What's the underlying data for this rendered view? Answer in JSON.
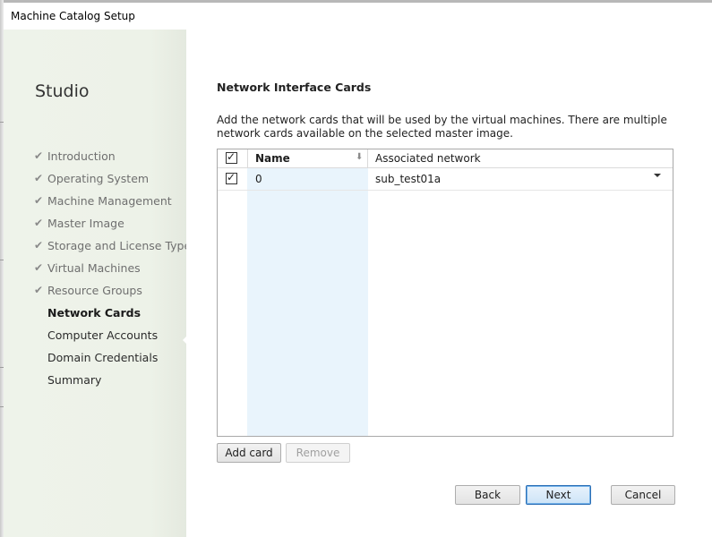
{
  "window": {
    "title": "Machine Catalog Setup"
  },
  "sidebar": {
    "heading": "Studio",
    "items": [
      {
        "label": "Introduction",
        "state": "done"
      },
      {
        "label": "Operating System",
        "state": "done"
      },
      {
        "label": "Machine Management",
        "state": "done"
      },
      {
        "label": "Master Image",
        "state": "done"
      },
      {
        "label": "Storage and License Types",
        "state": "done"
      },
      {
        "label": "Virtual Machines",
        "state": "done"
      },
      {
        "label": "Resource Groups",
        "state": "done"
      },
      {
        "label": "Network Cards",
        "state": "active"
      },
      {
        "label": "Computer Accounts",
        "state": "pending"
      },
      {
        "label": "Domain Credentials",
        "state": "pending"
      },
      {
        "label": "Summary",
        "state": "pending"
      }
    ],
    "check_glyph": "✔"
  },
  "main": {
    "title": "Network Interface Cards",
    "description": "Add the network cards that will be used by the virtual machines. There are multiple network cards available on the selected master image.",
    "table": {
      "columns": [
        "Name",
        "Associated network"
      ],
      "select_all_checked": true,
      "sort_icon": "sort-arrow-down-icon",
      "rows": [
        {
          "checked": true,
          "name": "0",
          "network": "sub_test01a"
        }
      ]
    },
    "add_card_label": "Add card",
    "remove_label": "Remove"
  },
  "footer": {
    "back_label": "Back",
    "next_label": "Next",
    "cancel_label": "Cancel"
  },
  "colors": {
    "sidebar_bg": "#eef3ea",
    "column_highlight": "#e9f4fc",
    "primary_border": "#2c6fb5"
  }
}
